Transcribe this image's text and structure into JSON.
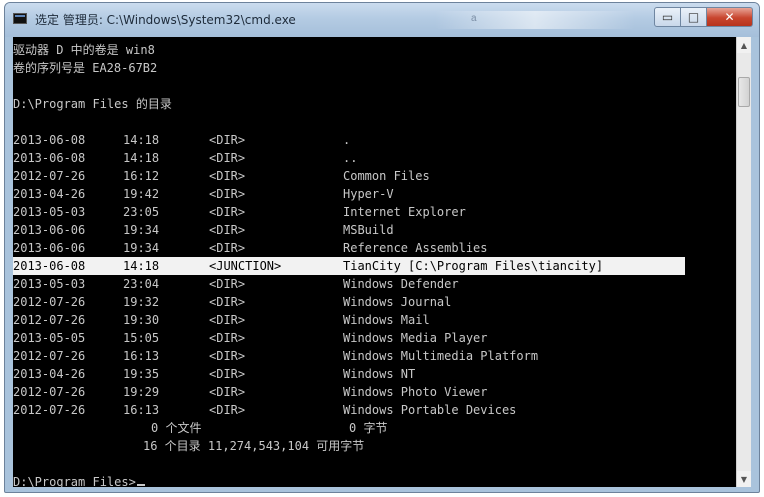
{
  "window": {
    "title": "选定 管理员: C:\\Windows\\System32\\cmd.exe",
    "background_tab": "a",
    "buttons": {
      "minimize": "▭",
      "maximize": "□",
      "close": "✕"
    }
  },
  "console": {
    "header": [
      "驱动器 D 中的卷是 win8",
      "卷的序列号是 EA28-67B2",
      "",
      "D:\\Program Files 的目录"
    ],
    "entries": [
      {
        "date": "2013-06-08",
        "time": "14:18",
        "type": "<DIR>",
        "name": "."
      },
      {
        "date": "2013-06-08",
        "time": "14:18",
        "type": "<DIR>",
        "name": ".."
      },
      {
        "date": "2012-07-26",
        "time": "16:12",
        "type": "<DIR>",
        "name": "Common Files"
      },
      {
        "date": "2013-04-26",
        "time": "19:42",
        "type": "<DIR>",
        "name": "Hyper-V"
      },
      {
        "date": "2013-05-03",
        "time": "23:05",
        "type": "<DIR>",
        "name": "Internet Explorer"
      },
      {
        "date": "2013-06-06",
        "time": "19:34",
        "type": "<DIR>",
        "name": "MSBuild"
      },
      {
        "date": "2013-06-06",
        "time": "19:34",
        "type": "<DIR>",
        "name": "Reference Assemblies"
      },
      {
        "date": "2013-06-08",
        "time": "14:18",
        "type": "<JUNCTION>",
        "name": "TianCity [C:\\Program Files\\tiancity]"
      },
      {
        "date": "2013-05-03",
        "time": "23:04",
        "type": "<DIR>",
        "name": "Windows Defender"
      },
      {
        "date": "2012-07-26",
        "time": "19:32",
        "type": "<DIR>",
        "name": "Windows Journal"
      },
      {
        "date": "2012-07-26",
        "time": "19:30",
        "type": "<DIR>",
        "name": "Windows Mail"
      },
      {
        "date": "2013-05-05",
        "time": "15:05",
        "type": "<DIR>",
        "name": "Windows Media Player"
      },
      {
        "date": "2012-07-26",
        "time": "16:13",
        "type": "<DIR>",
        "name": "Windows Multimedia Platform"
      },
      {
        "date": "2013-04-26",
        "time": "19:35",
        "type": "<DIR>",
        "name": "Windows NT"
      },
      {
        "date": "2012-07-26",
        "time": "19:29",
        "type": "<DIR>",
        "name": "Windows Photo Viewer"
      },
      {
        "date": "2012-07-26",
        "time": "16:13",
        "type": "<DIR>",
        "name": "Windows Portable Devices"
      }
    ],
    "summary": {
      "files_count": "0 个文件",
      "files_bytes": "0 字节",
      "dirs_line": "16 个目录 11,274,543,104 可用字节"
    },
    "prompt": "D:\\Program Files>"
  },
  "colors": {
    "console_bg": "#000000",
    "console_fg": "#c8c8c8",
    "selection_bg": "#f2f2f2",
    "selection_fg": "#000000"
  }
}
